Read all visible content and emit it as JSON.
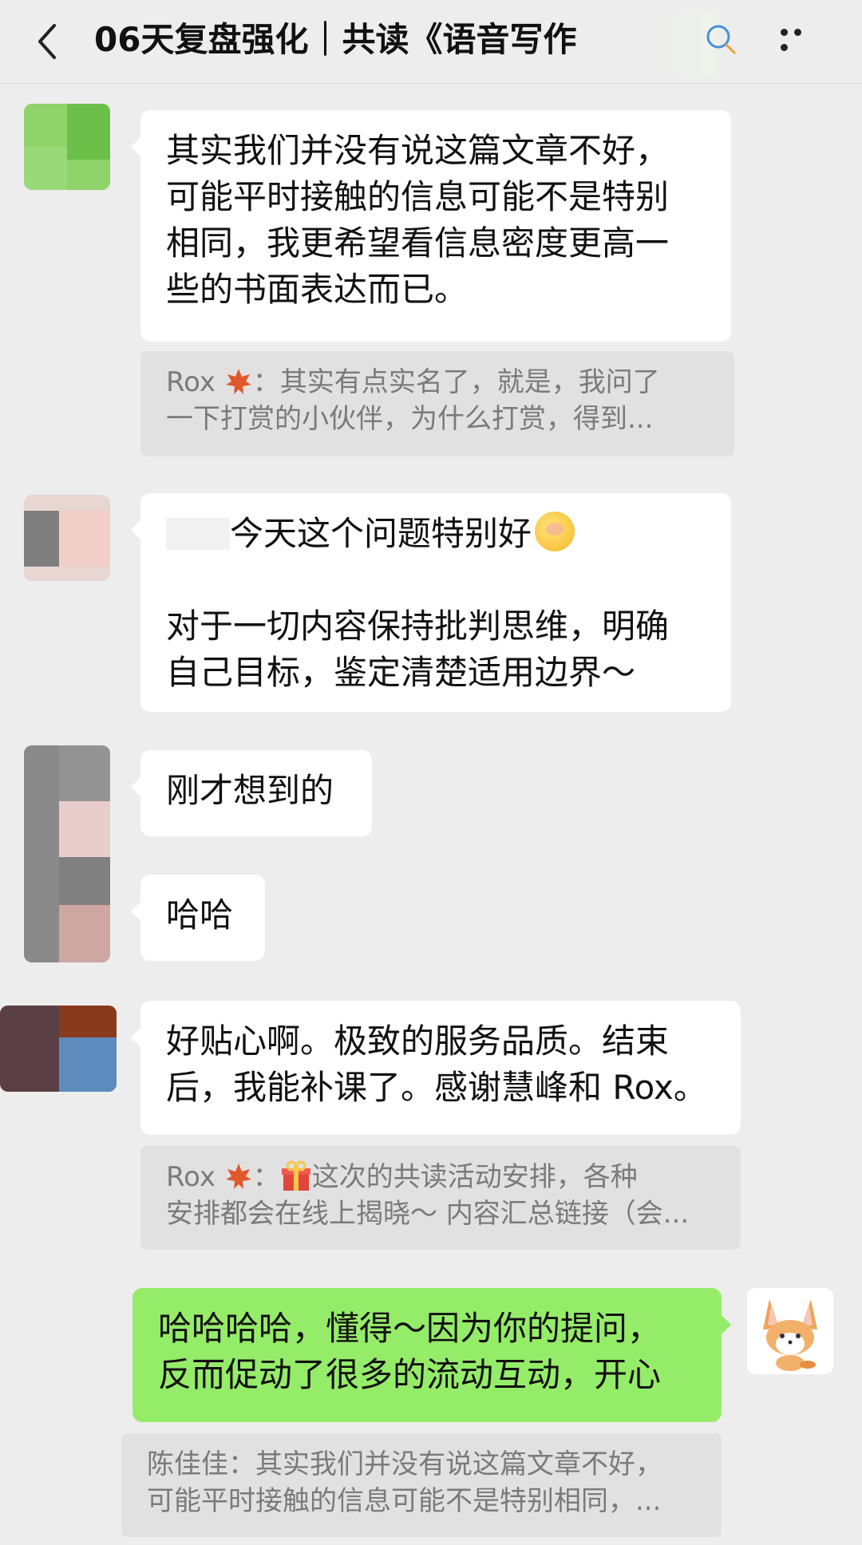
{
  "header": {
    "title": "06天复盘强化｜共读《语音写作",
    "back_icon": "chevron-left-icon",
    "more_icon": "more-dots-icon"
  },
  "messages": {
    "m1": {
      "lines": [
        "其实我们并没有说这篇文章不好，",
        "可能平时接触的信息可能不是特别",
        "相同，我更希望看信息密度更高一",
        "些的书面表达而已。"
      ]
    },
    "q1": {
      "sender": "Rox",
      "line1_rest": "：其实有点实名了，就是，我问了",
      "line2": "一下打赏的小伙伴，为什么打赏，得到..."
    },
    "m2": {
      "line1": "今天这个问题特别好",
      "line3": "对于一切内容保持批判思维，明确",
      "line4": "自己目标，鉴定清楚适用边界～"
    },
    "m3": {
      "text": "刚才想到的"
    },
    "m4": {
      "text": "哈哈"
    },
    "m5": {
      "lines": [
        "好贴心啊。极致的服务品质。结束",
        "后，我能补课了。感谢慧峰和 Rox。"
      ]
    },
    "q2": {
      "sender": "Rox",
      "line1_rest": "：",
      "line1_tail": "这次的共读活动安排，各种",
      "line2": "安排都会在线上揭晓～ 内容汇总链接（会..."
    },
    "m6": {
      "lines": [
        "哈哈哈哈，懂得～因为你的提问，",
        "反而促动了很多的流动互动，开心"
      ]
    },
    "q3": {
      "line1": "陈佳佳：其实我们并没有说这篇文章不好，",
      "line2": "可能平时接触的信息可能不是特别相同，..."
    }
  },
  "colors": {
    "background": "#ededed",
    "bubble_other": "#ffffff",
    "bubble_mine": "#95ec69",
    "quote_bg": "#e1e1e1",
    "quote_text": "#7a7a7a"
  }
}
